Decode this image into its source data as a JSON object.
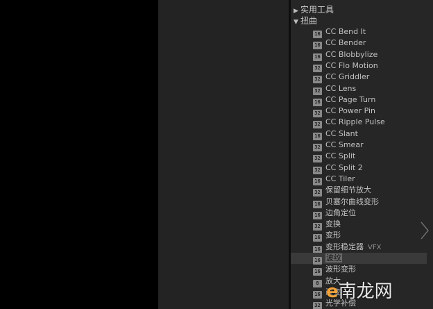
{
  "categories": [
    {
      "label": "实用工具",
      "expanded": false
    },
    {
      "label": "扭曲",
      "expanded": true
    }
  ],
  "effects": [
    {
      "label": "CC Bend It",
      "bits": "16"
    },
    {
      "label": "CC Bender",
      "bits": "16"
    },
    {
      "label": "CC Blobbylize",
      "bits": "16"
    },
    {
      "label": "CC Flo Motion",
      "bits": "32"
    },
    {
      "label": "CC Griddler",
      "bits": "32"
    },
    {
      "label": "CC Lens",
      "bits": "32"
    },
    {
      "label": "CC Page Turn",
      "bits": "16"
    },
    {
      "label": "CC Power Pin",
      "bits": "32"
    },
    {
      "label": "CC Ripple Pulse",
      "bits": "32"
    },
    {
      "label": "CC Slant",
      "bits": "16"
    },
    {
      "label": "CC Smear",
      "bits": "32"
    },
    {
      "label": "CC Split",
      "bits": "32"
    },
    {
      "label": "CC Split 2",
      "bits": "32"
    },
    {
      "label": "CC Tiler",
      "bits": "16"
    },
    {
      "label": "保留细节放大",
      "bits": "32"
    },
    {
      "label": "贝塞尔曲线变形",
      "bits": "16"
    },
    {
      "label": "边角定位",
      "bits": "16"
    },
    {
      "label": "变换",
      "bits": "32"
    },
    {
      "label": "变形",
      "bits": "16"
    },
    {
      "label": "变形稳定器",
      "bits": "16",
      "tag": "VFX"
    },
    {
      "label": "波纹",
      "bits": "16",
      "selected": true
    },
    {
      "label": "波形变形",
      "bits": "16"
    },
    {
      "label": "放大",
      "bits": "8"
    },
    {
      "label": "改变",
      "bits": "16"
    },
    {
      "label": "光学补偿",
      "bits": "32"
    }
  ],
  "watermark": {
    "e": "e",
    "text": "南龙网"
  },
  "colors": {
    "selected_row": "#3a3a3a",
    "badge": "#8a8a8a"
  }
}
